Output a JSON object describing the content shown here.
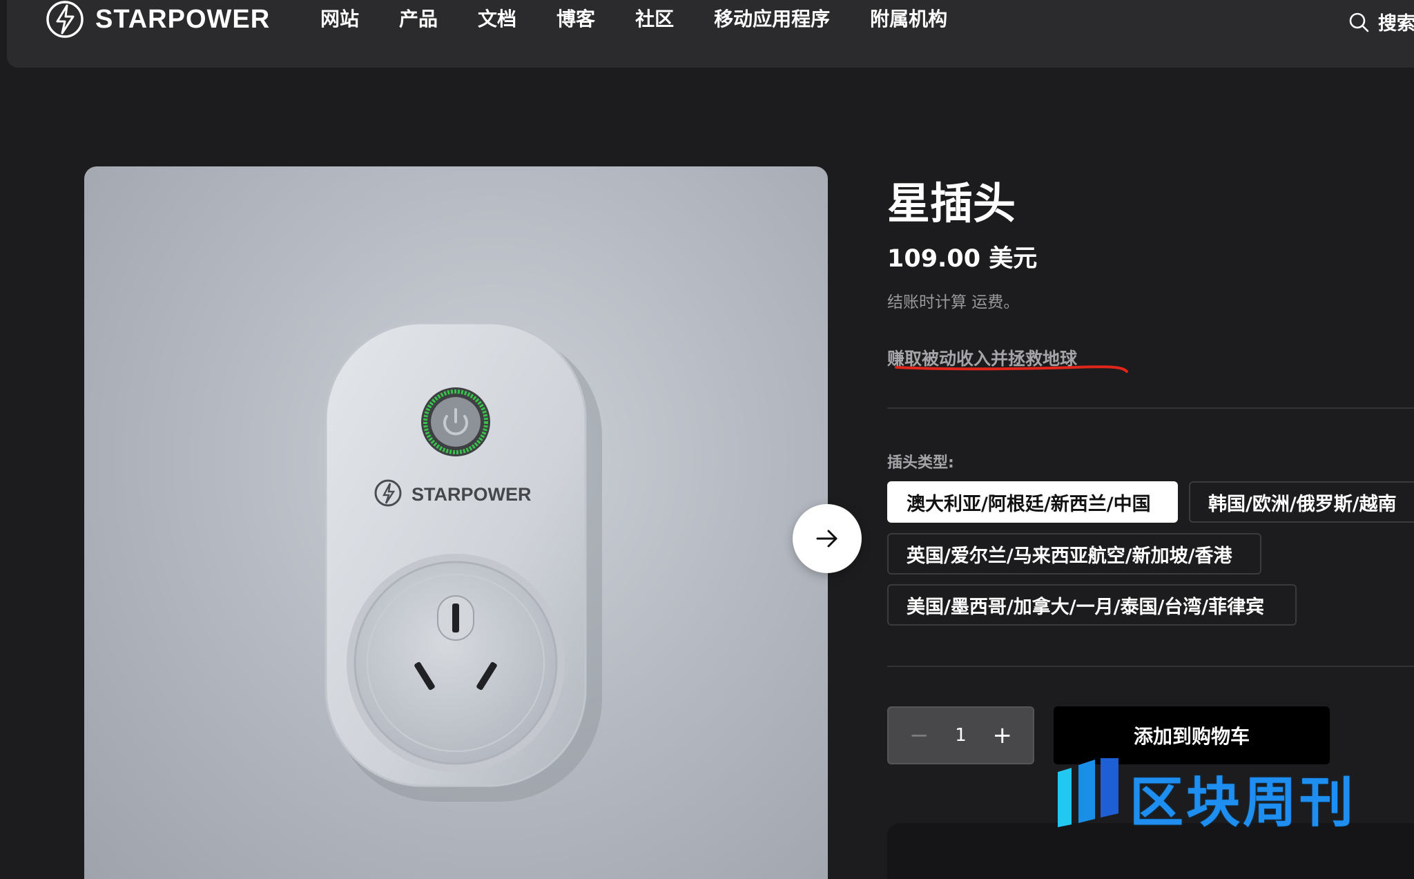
{
  "brand": {
    "name": "STARPOWER"
  },
  "nav": {
    "items": [
      "网站",
      "产品",
      "文档",
      "博客",
      "社区",
      "移动应用程序",
      "附属机构"
    ],
    "search_label": "搜索"
  },
  "gallery": {
    "device_brand": "STARPOWER"
  },
  "product": {
    "title": "星插头",
    "price": "109.00 美元",
    "shipping_note": "结账时计算 运费。",
    "tagline": "赚取被动收入并拯救地球",
    "plug_type_label": "插头类型:",
    "plug_options": [
      "澳大利亚/阿根廷/新西兰/中国",
      "韩国/欧洲/俄罗斯/越南",
      "英国/爱尔兰/马来西亚航空/新加坡/香港",
      "美国/墨西哥/加拿大/一月/泰国/台湾/菲律宾"
    ],
    "selected_option": "澳大利亚/阿根廷/新西兰/中国",
    "quantity": "1",
    "quantity_minus": "−",
    "quantity_plus": "+",
    "add_to_cart": "添加到购物车"
  },
  "watermark": {
    "text": "区块周刊"
  },
  "colors": {
    "background": "#1c1c1e",
    "header": "#2b2b2d",
    "underline_annotation": "#e0251b",
    "watermark": "#1e8ff0"
  }
}
